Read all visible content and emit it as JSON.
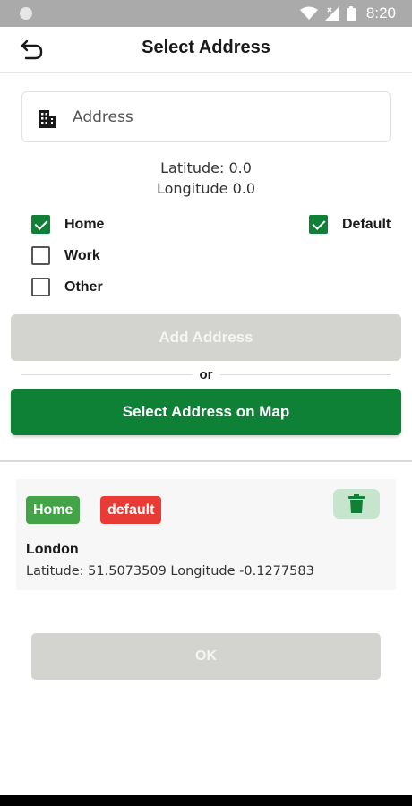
{
  "status_bar": {
    "time": "8:20",
    "icons": [
      "wifi-icon",
      "signal-icon",
      "battery-icon"
    ]
  },
  "app_bar": {
    "title": "Select Address",
    "back_icon": "back-arrow-icon"
  },
  "address_input": {
    "placeholder": "Address",
    "value": "",
    "icon": "building-icon"
  },
  "coordinates": {
    "latitude": "Latitude: 0.0",
    "longitude": "Longitude 0.0"
  },
  "address_types": [
    {
      "label": "Home",
      "checked": true
    },
    {
      "label": "Work",
      "checked": false
    },
    {
      "label": "Other",
      "checked": false
    }
  ],
  "default_option": {
    "label": "Default",
    "checked": true
  },
  "buttons": {
    "add_address": "Add Address",
    "or": "or",
    "select_on_map": "Select Address on Map",
    "ok": "OK"
  },
  "saved_address": {
    "tag": "Home",
    "default_tag": "default",
    "city": "London",
    "coords": "Latitude: 51.5073509 Longitude -0.1277583",
    "delete_icon": "trash-icon"
  },
  "colors": {
    "primary_green": "#0e8136",
    "disabled_gray": "#d3d3cf",
    "home_tag_green": "#43a347",
    "default_tag_red": "#e93b36",
    "delete_bg": "#c6e5cc"
  }
}
